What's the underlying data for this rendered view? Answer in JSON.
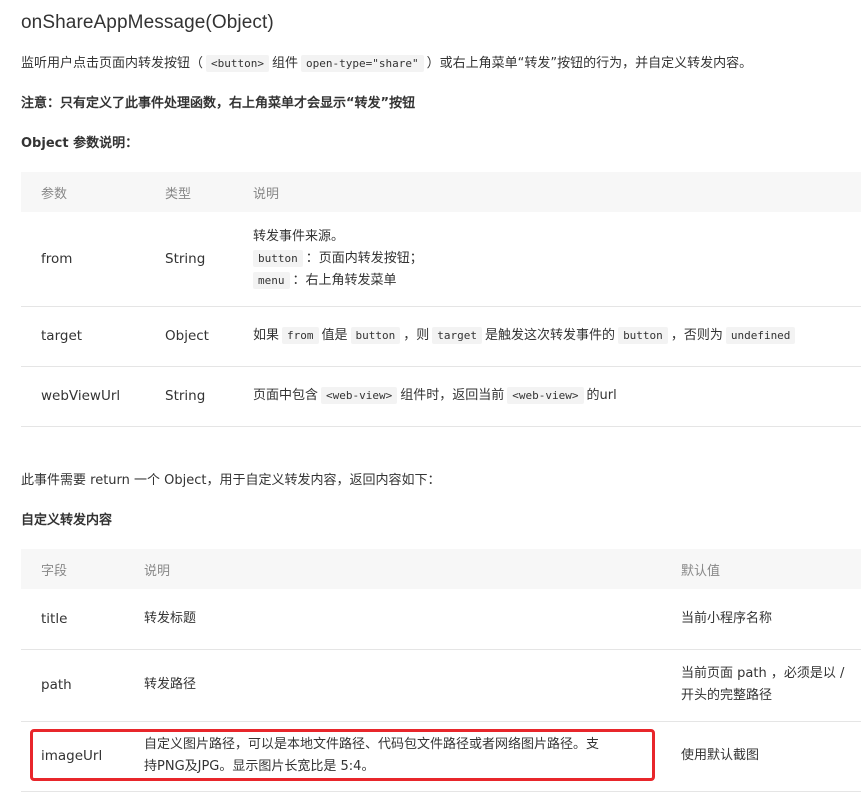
{
  "title": "onShareAppMessage(Object)",
  "desc": {
    "p1": "监听用户点击页面内转发按钮（",
    "code1": "<button>",
    "p2": "组件",
    "code2": "open-type=\"share\"",
    "p3": "）或右上角菜单“转发”按钮的行为，并自定义转发内容。"
  },
  "note": "注意：只有定义了此事件处理函数，右上角菜单才会显示“转发”按钮",
  "object_heading": "Object 参数说明：",
  "params_table": {
    "headers": [
      "参数",
      "类型",
      "说明"
    ],
    "from": {
      "name": "from",
      "type": "String",
      "line1": "转发事件来源。",
      "code_button": "button",
      "line2": "：页面内转发按钮；",
      "code_menu": "menu",
      "line3": "：右上角转发菜单"
    },
    "target": {
      "name": "target",
      "type": "Object",
      "t1": "如果",
      "c1": "from",
      "t2": "值是",
      "c2": "button",
      "t3": "，则",
      "c3": "target",
      "t4": "是触发这次转发事件的",
      "c4": "button",
      "t5": "，否则为",
      "c5": "undefined"
    },
    "webViewUrl": {
      "name": "webViewUrl",
      "type": "String",
      "t1": "页面中包含",
      "c1": "<web-view>",
      "t2": "组件时，返回当前",
      "c2": "<web-view>",
      "t3": "的url"
    }
  },
  "return_text": "此事件需要 return 一个 Object，用于自定义转发内容，返回内容如下：",
  "custom_heading": "自定义转发内容",
  "custom_table": {
    "headers": [
      "字段",
      "说明",
      "默认值"
    ],
    "rows": {
      "title": {
        "field": "title",
        "desc": "转发标题",
        "default": "当前小程序名称"
      },
      "path": {
        "field": "path",
        "desc": "转发路径",
        "default_line1": "当前页面 path ，必须是以 /",
        "default_line2": "开头的完整路径"
      },
      "imageUrl": {
        "field": "imageUrl",
        "desc_line1": "自定义图片路径，可以是本地文件路径、代码包文件路径或者网络图片路径。支",
        "desc_line2": "持PNG及JPG。显示图片长宽比是 5:4。",
        "default": "使用默认截图"
      }
    }
  },
  "colors": {
    "highlight": "#e8262b",
    "header_bg": "#f7f7f7",
    "code_bg": "#f3f3f3"
  }
}
